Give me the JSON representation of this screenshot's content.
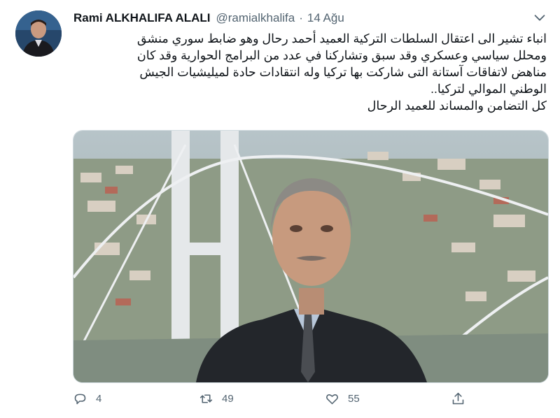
{
  "tweet": {
    "author_name": "Rami ALKHALIFA ALALI",
    "handle": "@ramialkhalifa",
    "separator": "·",
    "date": "14 Ağu",
    "lines": [
      "انباء تشير الى اعتقال السلطات التركية العميد أحمد رحال وهو ضابط سوري منشق",
      "ومحلل سياسي وعسكري وقد سبق وتشاركنا في عدد من البرامج الحوارية وقد كان",
      "مناهض لاتفاقات آستانة التى شاركت بها تركيا وله انتقادات حادة لميليشيات الجيش",
      "الوطني الموالي لتركيا..",
      "كل التضامن والمساند للعميد الرحال"
    ]
  },
  "actions": {
    "reply_count": "4",
    "retweet_count": "49",
    "like_count": "55"
  },
  "icons": {
    "menu": "chevron-down-icon",
    "reply": "reply-icon",
    "retweet": "retweet-icon",
    "like": "heart-icon",
    "share": "share-icon"
  },
  "colors": {
    "text": "#0f1419",
    "secondary": "#536471",
    "border": "#cfd9de"
  }
}
